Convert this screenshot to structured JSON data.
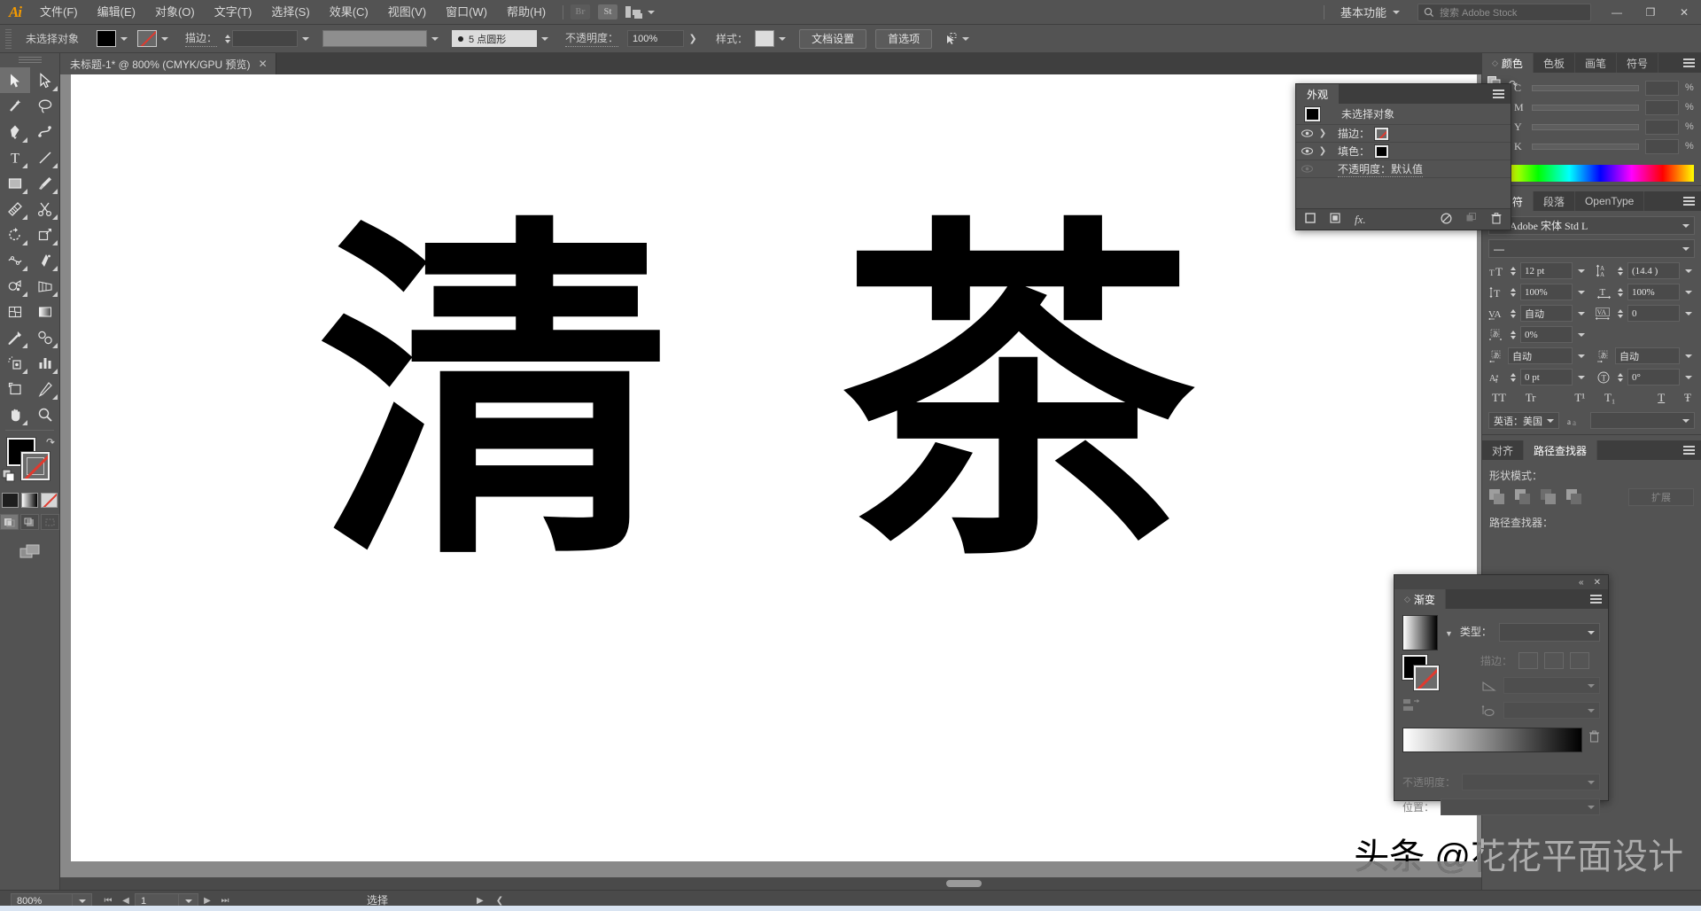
{
  "app": {
    "name": "Adobe Illustrator",
    "logo": "Ai",
    "accent": "#f59b00",
    "chrome_bg": "#535353"
  },
  "menubar": {
    "items": [
      {
        "label": "文件(F)"
      },
      {
        "label": "编辑(E)"
      },
      {
        "label": "对象(O)"
      },
      {
        "label": "文字(T)"
      },
      {
        "label": "选择(S)"
      },
      {
        "label": "效果(C)"
      },
      {
        "label": "视图(V)"
      },
      {
        "label": "窗口(W)"
      },
      {
        "label": "帮助(H)"
      }
    ],
    "bridge_badge": "Br",
    "stock_badge": "St",
    "arrange_icon": "arrange-documents-icon",
    "workspace": "基本功能",
    "search_placeholder": "搜索 Adobe Stock",
    "search_value": "",
    "window_buttons": {
      "minimize": "—",
      "restore": "❐",
      "close": "✕"
    }
  },
  "controlbar": {
    "selection_label": "未选择对象",
    "fill_color": "#000000",
    "stroke_color": "none",
    "stroke_label": "描边：",
    "stroke_weight": "",
    "stroke_profile": "",
    "brush_definition": "5 点圆形",
    "opacity_label": "不透明度：",
    "opacity_value": "100%",
    "style_label": "样式：",
    "style_swatch": "#dcdcdc",
    "doc_setup_button": "文档设置",
    "preferences_button": "首选项",
    "select_similar_icon": "select-similar-objects-icon"
  },
  "tabbar": {
    "tabs": [
      {
        "title": "未标题-1* @ 800% (CMYK/GPU 预览)",
        "close": "✕",
        "active": true
      }
    ]
  },
  "toolbar": {
    "tools": [
      {
        "name": "selection-tool",
        "glyph": "selection",
        "active": true,
        "corner": false
      },
      {
        "name": "direct-selection-tool",
        "glyph": "direct-selection",
        "active": false,
        "corner": true
      },
      {
        "name": "magic-wand-tool",
        "glyph": "magic-wand",
        "active": false,
        "corner": false
      },
      {
        "name": "lasso-tool",
        "glyph": "lasso",
        "active": false,
        "corner": false
      },
      {
        "name": "pen-tool",
        "glyph": "pen",
        "active": false,
        "corner": true
      },
      {
        "name": "curvature-tool",
        "glyph": "curvature",
        "active": false,
        "corner": false
      },
      {
        "name": "type-tool",
        "glyph": "type",
        "active": false,
        "corner": true
      },
      {
        "name": "line-segment-tool",
        "glyph": "line",
        "active": false,
        "corner": true
      },
      {
        "name": "rectangle-tool",
        "glyph": "rectangle",
        "active": false,
        "corner": true
      },
      {
        "name": "paintbrush-tool",
        "glyph": "paintbrush",
        "active": false,
        "corner": true
      },
      {
        "name": "shaper-tool",
        "glyph": "shaper",
        "active": false,
        "corner": true
      },
      {
        "name": "scissors-tool",
        "glyph": "scissors",
        "active": false,
        "corner": true
      },
      {
        "name": "rotate-tool",
        "glyph": "rotate",
        "active": false,
        "corner": true
      },
      {
        "name": "scale-tool",
        "glyph": "scale",
        "active": false,
        "corner": true
      },
      {
        "name": "width-tool",
        "glyph": "width",
        "active": false,
        "corner": true
      },
      {
        "name": "free-transform-tool",
        "glyph": "free-transform",
        "active": false,
        "corner": true
      },
      {
        "name": "shape-builder-tool",
        "glyph": "shape-builder",
        "active": false,
        "corner": true
      },
      {
        "name": "perspective-grid-tool",
        "glyph": "perspective",
        "active": false,
        "corner": true
      },
      {
        "name": "mesh-tool",
        "glyph": "mesh",
        "active": false,
        "corner": false
      },
      {
        "name": "gradient-tool",
        "glyph": "gradient",
        "active": false,
        "corner": false
      },
      {
        "name": "eyedropper-tool",
        "glyph": "eyedropper",
        "active": false,
        "corner": true
      },
      {
        "name": "blend-tool",
        "glyph": "blend",
        "active": false,
        "corner": true
      },
      {
        "name": "symbol-sprayer-tool",
        "glyph": "symbol-sprayer",
        "active": false,
        "corner": true
      },
      {
        "name": "column-graph-tool",
        "glyph": "column-graph",
        "active": false,
        "corner": true
      },
      {
        "name": "artboard-tool",
        "glyph": "artboard",
        "active": false,
        "corner": false
      },
      {
        "name": "slice-tool",
        "glyph": "slice",
        "active": false,
        "corner": true
      },
      {
        "name": "hand-tool",
        "glyph": "hand",
        "active": false,
        "corner": true
      },
      {
        "name": "zoom-tool",
        "glyph": "zoom",
        "active": false,
        "corner": false
      }
    ],
    "fill_color": "#000000",
    "stroke_color": "none",
    "swap_icon": "swap-fill-stroke-icon",
    "default_icon": "default-fill-stroke-icon",
    "modes": [
      "color-swatch",
      "gradient-swatch",
      "none-swatch"
    ],
    "draw_modes": [
      "draw-normal",
      "draw-behind",
      "draw-inside"
    ],
    "screen_mode_icon": "change-screen-mode-icon"
  },
  "canvas": {
    "artwork_text": "清茶",
    "glyph_1": "清",
    "glyph_2": "茶",
    "artboard_bg": "#ffffff",
    "canvas_bg": "#898989"
  },
  "watermark": {
    "text": "头条 @花花平面设计"
  },
  "appearance_panel": {
    "tab": "外观",
    "target": "未选择对象",
    "rows": [
      {
        "label": "描边：",
        "swatch": "none",
        "expandable": true,
        "visible": true
      },
      {
        "label": "填色：",
        "swatch": "#000000",
        "expandable": true,
        "visible": true
      },
      {
        "label": "不透明度：默认值",
        "swatch": null,
        "expandable": false,
        "visible": false
      }
    ],
    "footer_icons": [
      "add-new-stroke-icon",
      "add-new-fill-icon",
      "add-new-effect-icon",
      "clear-appearance-icon",
      "duplicate-item-icon",
      "delete-item-icon"
    ]
  },
  "color_panel": {
    "tabs": [
      "颜色",
      "色板",
      "画笔",
      "符号"
    ],
    "active_tab": "颜色",
    "mode": "CMYK",
    "channels": [
      {
        "label": "C",
        "value": "",
        "unit": "%"
      },
      {
        "label": "M",
        "value": "",
        "unit": "%"
      },
      {
        "label": "Y",
        "value": "",
        "unit": "%"
      },
      {
        "label": "K",
        "value": "",
        "unit": "%"
      }
    ],
    "fill_stroke_icon": "fill-stroke-proxy-icon",
    "swap_icon": "swap-colors-icon"
  },
  "character_panel": {
    "tabs": [
      "字符",
      "段落",
      "OpenType"
    ],
    "active_tab": "字符",
    "font_family": "Adobe 宋体 Std L",
    "font_style": "—",
    "font_size": "12 pt",
    "leading": "(14.4 )",
    "vertical_scale": "100%",
    "horizontal_scale": "100%",
    "kerning": "自动",
    "tracking": "0",
    "tsume": "0%",
    "aki_before": "自动",
    "aki_after": "自动",
    "baseline_shift": "0 pt",
    "character_rotation": "0°",
    "caps_buttons": [
      "TT",
      "Tr",
      "T¹",
      "T₁",
      "T",
      "Ŧ"
    ],
    "language": "英语：美国",
    "anti_alias": ""
  },
  "pathfinder_panel": {
    "tabs": [
      "对齐",
      "路径查找器"
    ],
    "active_tab": "路径查找器",
    "shape_modes_label": "形状模式：",
    "pathfinders_label": "路径查找器：",
    "expand_button": "扩展",
    "shape_mode_icons": [
      "unite-icon",
      "minus-front-icon",
      "intersect-icon",
      "exclude-icon"
    ]
  },
  "gradient_panel": {
    "title": "渐变",
    "type_label": "类型：",
    "type_value": "",
    "stroke_label": "描边：",
    "angle_label": "angle",
    "angle_value": "",
    "aspect_label": "aspect-ratio",
    "aspect_value": "",
    "opacity_label": "不透明度：",
    "opacity_value": "",
    "location_label": "位置：",
    "location_value": "",
    "gradient_preview": "white-to-black",
    "fill_color": "#000000",
    "stroke_color": "none",
    "collapse_icon": "collapse-panel-icon",
    "close_icon": "close-panel-icon",
    "delete_stop_icon": "delete-gradient-stop-icon"
  },
  "statusbar": {
    "zoom_level": "800%",
    "page_number": "1",
    "status_text": "选择",
    "first_icon": "first-artboard-icon",
    "prev_icon": "previous-artboard-icon",
    "next_icon": "next-artboard-icon",
    "last_icon": "last-artboard-icon"
  }
}
